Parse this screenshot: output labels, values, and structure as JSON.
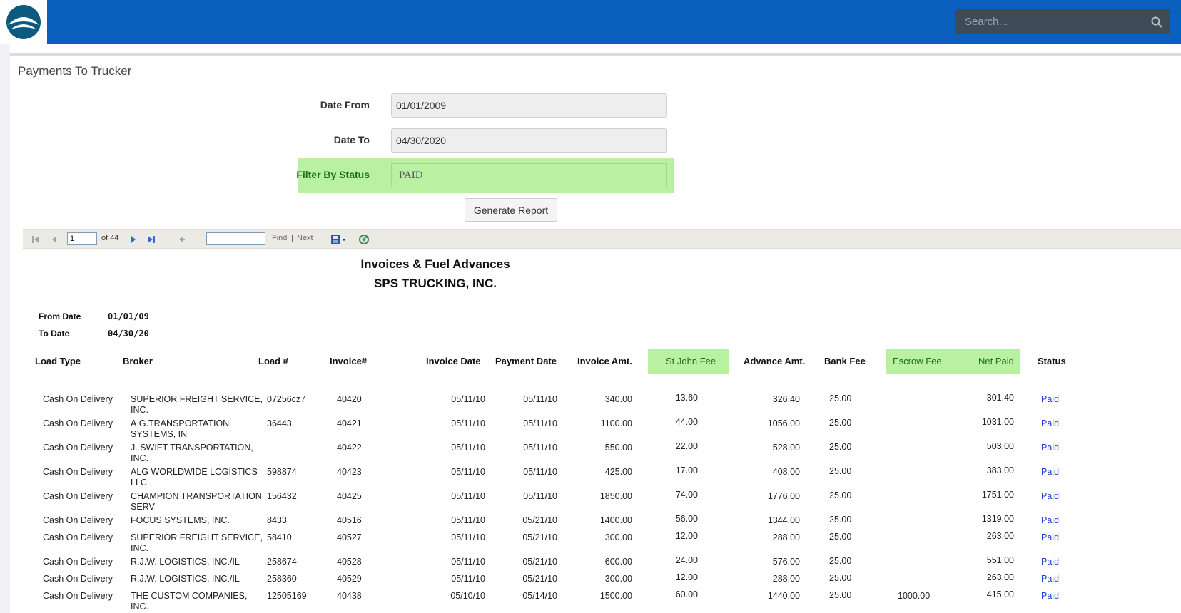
{
  "header": {
    "logo": "app-logo",
    "search_placeholder": "Search..."
  },
  "page": {
    "title": "Payments To Trucker"
  },
  "form": {
    "date_from_label": "Date From",
    "date_from_value": "01/01/2009",
    "date_to_label": "Date To",
    "date_to_value": "04/30/2020",
    "status_label": "Filter By Status",
    "status_value": "PAID",
    "generate_label": "Generate Report"
  },
  "toolbar": {
    "page_value": "1",
    "of_text": "of 44",
    "find_label": "Find",
    "sep": "|",
    "next_label": "Next"
  },
  "report": {
    "title": "Invoices & Fuel Advances",
    "company": "SPS TRUCKING, INC.",
    "from_label": "From Date",
    "from_value": "01/01/09",
    "to_label": "To Date",
    "to_value": "04/30/20",
    "columns": {
      "load_type": "Load Type",
      "broker": "Broker",
      "load_no": "Load #",
      "invoice_no": "Invoice#",
      "invoice_date": "Invoice Date",
      "payment_date": "Payment Date",
      "invoice_amt": "Invoice  Amt.",
      "st_john_fee": "St John Fee",
      "advance_amt": "Advance Amt.",
      "bank_fee": "Bank Fee",
      "escrow_fee": "Escrow Fee",
      "net_paid": "Net Paid",
      "status": "Status"
    },
    "rows": [
      {
        "load_type": "Cash On Delivery",
        "broker": "SUPERIOR FREIGHT SERVICE, INC.",
        "load_no": "07256cz7",
        "invoice_no": "40420",
        "invoice_date": "05/11/10",
        "payment_date": "05/11/10",
        "invoice_amt": "340.00",
        "st_john_fee": "13.60",
        "advance_amt": "326.40",
        "bank_fee": "25.00",
        "escrow_fee": "",
        "net_paid": "301.40",
        "status": "Paid"
      },
      {
        "load_type": "Cash On Delivery",
        "broker": "A.G.TRANSPORTATION SYSTEMS, IN",
        "load_no": "36443",
        "invoice_no": "40421",
        "invoice_date": "05/11/10",
        "payment_date": "05/11/10",
        "invoice_amt": "1100.00",
        "st_john_fee": "44.00",
        "advance_amt": "1056.00",
        "bank_fee": "25.00",
        "escrow_fee": "",
        "net_paid": "1031.00",
        "status": "Paid"
      },
      {
        "load_type": "Cash On Delivery",
        "broker": " J. SWIFT TRANSPORTATION, INC.",
        "load_no": "",
        "invoice_no": "40422",
        "invoice_date": "05/11/10",
        "payment_date": "05/11/10",
        "invoice_amt": "550.00",
        "st_john_fee": "22.00",
        "advance_amt": "528.00",
        "bank_fee": "25.00",
        "escrow_fee": "",
        "net_paid": "503.00",
        "status": "Paid"
      },
      {
        "load_type": "Cash On Delivery",
        "broker": "ALG WORLDWIDE LOGISTICS LLC",
        "load_no": "598874",
        "invoice_no": "40423",
        "invoice_date": "05/11/10",
        "payment_date": "05/11/10",
        "invoice_amt": "425.00",
        "st_john_fee": "17.00",
        "advance_amt": "408.00",
        "bank_fee": "25.00",
        "escrow_fee": "",
        "net_paid": "383.00",
        "status": "Paid"
      },
      {
        "load_type": "Cash On Delivery",
        "broker": "CHAMPION TRANSPORTATION SERV",
        "load_no": "156432",
        "invoice_no": "40425",
        "invoice_date": "05/11/10",
        "payment_date": "05/11/10",
        "invoice_amt": "1850.00",
        "st_john_fee": "74.00",
        "advance_amt": "1776.00",
        "bank_fee": "25.00",
        "escrow_fee": "",
        "net_paid": "1751.00",
        "status": "Paid"
      },
      {
        "load_type": "Cash On Delivery",
        "broker": "FOCUS SYSTEMS, INC.",
        "load_no": "8433",
        "invoice_no": "40516",
        "invoice_date": "05/11/10",
        "payment_date": "05/21/10",
        "invoice_amt": "1400.00",
        "st_john_fee": "56.00",
        "advance_amt": "1344.00",
        "bank_fee": "25.00",
        "escrow_fee": "",
        "net_paid": "1319.00",
        "status": "Paid"
      },
      {
        "load_type": "Cash On Delivery",
        "broker": "SUPERIOR FREIGHT SERVICE, INC.",
        "load_no": "58410",
        "invoice_no": "40527",
        "invoice_date": "05/11/10",
        "payment_date": "05/21/10",
        "invoice_amt": "300.00",
        "st_john_fee": "12.00",
        "advance_amt": "288.00",
        "bank_fee": "25.00",
        "escrow_fee": "",
        "net_paid": "263.00",
        "status": "Paid"
      },
      {
        "load_type": "Cash On Delivery",
        "broker": "R.J.W. LOGISTICS, INC./IL",
        "load_no": "258674",
        "invoice_no": "40528",
        "invoice_date": "05/11/10",
        "payment_date": "05/21/10",
        "invoice_amt": "600.00",
        "st_john_fee": "24.00",
        "advance_amt": "576.00",
        "bank_fee": "25.00",
        "escrow_fee": "",
        "net_paid": "551.00",
        "status": "Paid"
      },
      {
        "load_type": "Cash On Delivery",
        "broker": "R.J.W. LOGISTICS, INC./IL",
        "load_no": "258360",
        "invoice_no": "40529",
        "invoice_date": "05/11/10",
        "payment_date": "05/21/10",
        "invoice_amt": "300.00",
        "st_john_fee": "12.00",
        "advance_amt": "288.00",
        "bank_fee": "25.00",
        "escrow_fee": "",
        "net_paid": "263.00",
        "status": "Paid"
      },
      {
        "load_type": "Cash On Delivery",
        "broker": "THE CUSTOM COMPANIES, INC.",
        "load_no": "12505169",
        "invoice_no": "40438",
        "invoice_date": "05/10/10",
        "payment_date": "05/14/10",
        "invoice_amt": "1500.00",
        "st_john_fee": "60.00",
        "advance_amt": "1440.00",
        "bank_fee": "25.00",
        "escrow_fee": "1000.00",
        "net_paid": "415.00",
        "status": "Paid"
      }
    ]
  },
  "colors": {
    "topbar": "#0a5fbf",
    "highlight": "#b9f0a2",
    "status_link": "#1a3fcc"
  }
}
